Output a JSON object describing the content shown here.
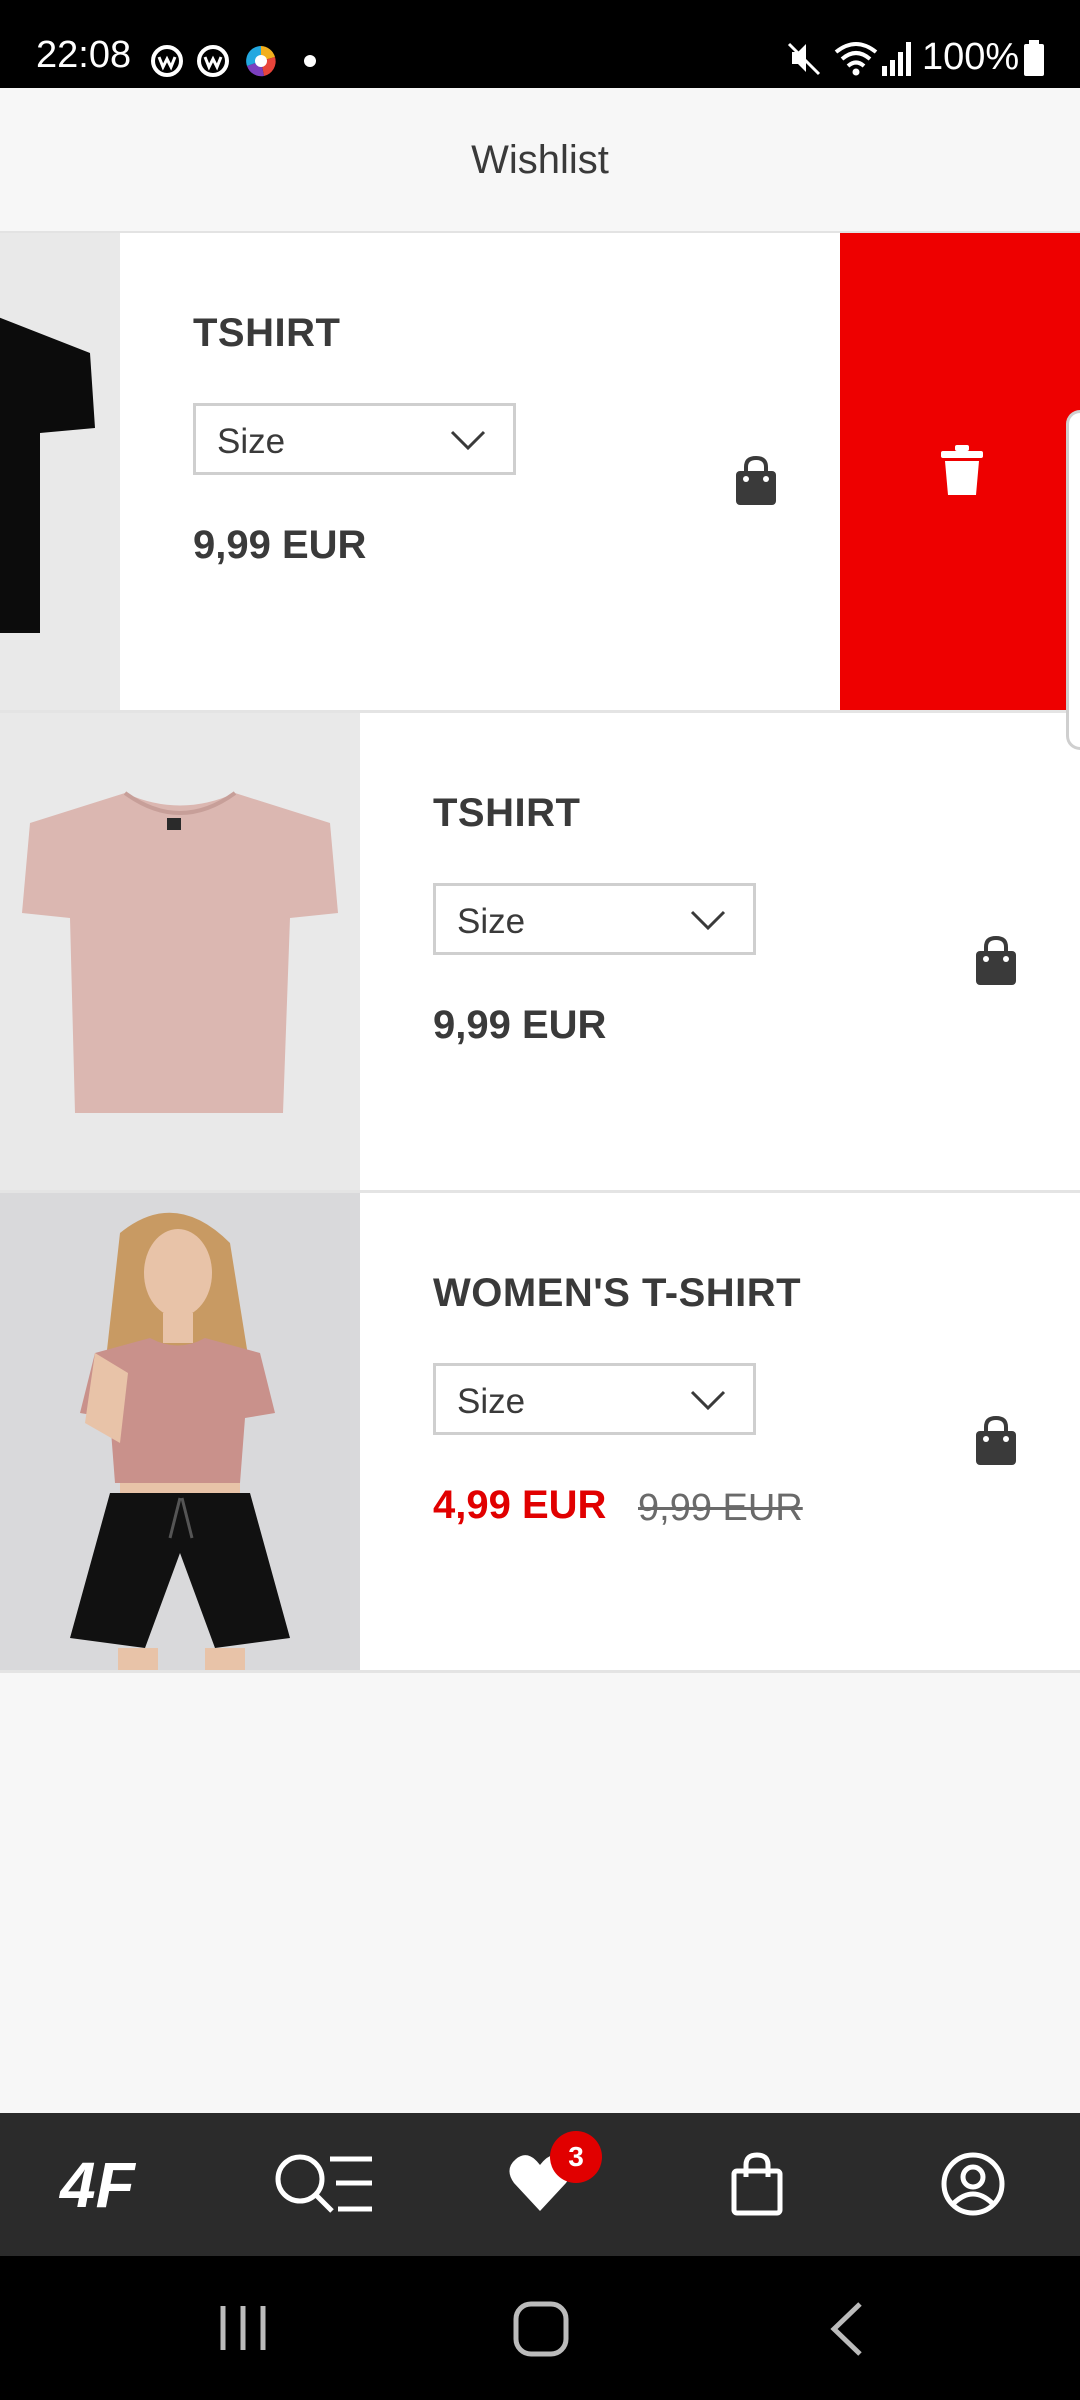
{
  "status_bar": {
    "time": "22:08",
    "battery": "100%",
    "icons": [
      "app-icon",
      "app-icon",
      "colorful-app-icon",
      "notification-dot",
      "mute-icon",
      "wifi-icon",
      "signal-icon",
      "battery-icon"
    ]
  },
  "header": {
    "title": "Wishlist"
  },
  "items": [
    {
      "name": "TSHIRT",
      "size_placeholder": "Size",
      "price": "9,99 EUR",
      "image": "black t-shirt",
      "swiped": true
    },
    {
      "name": "TSHIRT",
      "size_placeholder": "Size",
      "price": "9,99 EUR",
      "image": "pink t-shirt"
    },
    {
      "name": "WOMEN'S T-SHIRT",
      "size_placeholder": "Size",
      "price": "4,99 EUR",
      "old_price": "9,99 EUR",
      "image": "model in pink t-shirt"
    }
  ],
  "bottom_nav": {
    "items": [
      "4f-logo",
      "search-menu-icon",
      "wishlist-heart-icon",
      "shopping-bag-icon",
      "account-icon"
    ],
    "wishlist_count": "3"
  },
  "colors": {
    "accent_red": "#ee0000",
    "sale_red": "#e10000",
    "nav_bg": "#2b2b2b",
    "text_dark": "#3a3a3a"
  }
}
